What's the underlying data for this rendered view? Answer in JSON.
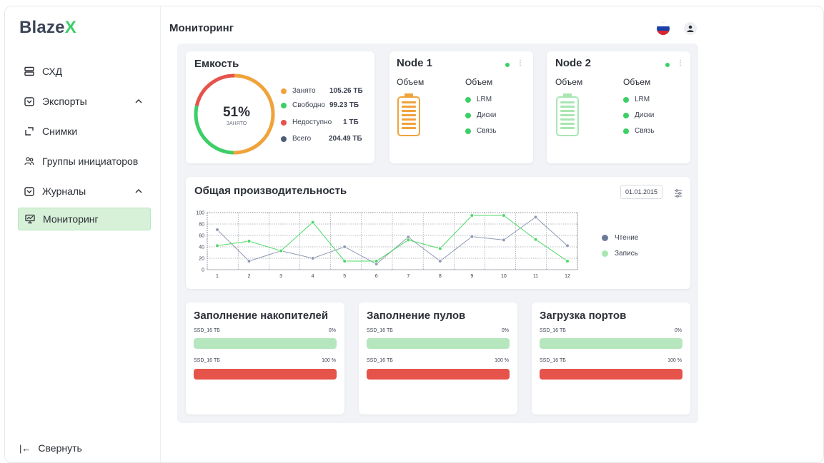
{
  "app": {
    "logo_main": "Blaze",
    "logo_accent": "X"
  },
  "sidebar": {
    "items": [
      {
        "label": "СХД",
        "icon": "storage-icon"
      },
      {
        "label": "Экспорты",
        "icon": "exports-icon",
        "expandable": true
      },
      {
        "label": "Снимки",
        "icon": "snapshots-icon"
      },
      {
        "label": "Группы инициаторов",
        "icon": "groups-icon"
      },
      {
        "label": "Журналы",
        "icon": "journals-icon",
        "expandable": true
      },
      {
        "label": "Мониторинг",
        "icon": "monitoring-icon",
        "active": true
      }
    ],
    "collapse_label": "Свернуть"
  },
  "header": {
    "title": "Мониторинг",
    "language": "ru"
  },
  "capacity": {
    "title": "Емкость",
    "percent": "51%",
    "percent_caption": "занято",
    "legend": [
      {
        "label": "Занято",
        "value": "105.26 ТБ",
        "color": "#f0a33b"
      },
      {
        "label": "Свободно",
        "value": "99.23 ТБ",
        "color": "#3ccf66"
      },
      {
        "label": "Недоступно",
        "value": "1 ТБ",
        "color": "#e5534b"
      },
      {
        "label": "Всего",
        "value": "204.49 ТБ",
        "color": "#4e5d78"
      }
    ]
  },
  "nodes": [
    {
      "title": "Node 1",
      "volume_label": "Объем",
      "volume_label_2": "Объем",
      "items": [
        "LRM",
        "Диски",
        "Связь"
      ],
      "battery_color": "#f0a33b"
    },
    {
      "title": "Node 2",
      "volume_label": "Объем",
      "volume_label_2": "Объем",
      "items": [
        "LRM",
        "Диски",
        "Связь"
      ],
      "battery_color": "#a8e6b2"
    }
  ],
  "performance": {
    "title": "Общая производительность",
    "date": "01.01.2015",
    "legend": [
      {
        "label": "Чтение",
        "color": "#6b7a99"
      },
      {
        "label": "Запись",
        "color": "#a8e6b2"
      }
    ]
  },
  "chart_data": {
    "type": "line",
    "x": [
      1,
      2,
      3,
      4,
      5,
      6,
      7,
      8,
      9,
      10,
      11,
      12
    ],
    "ylim": [
      0,
      100
    ],
    "yticks": [
      0,
      20,
      40,
      60,
      80,
      100
    ],
    "grid": true,
    "legend_position": "right",
    "series": [
      {
        "name": "Чтение",
        "values": [
          70,
          15,
          33,
          20,
          40,
          10,
          57,
          15,
          58,
          52,
          92,
          42
        ],
        "color": "#8f9bb3"
      },
      {
        "name": "Запись",
        "values": [
          42,
          50,
          33,
          83,
          15,
          15,
          52,
          37,
          95,
          95,
          53,
          15
        ],
        "color": "#4cd964"
      }
    ]
  },
  "fill_cards": [
    {
      "title": "Заполнение накопителей",
      "rows": [
        {
          "label": "SSD_16 ТБ",
          "pct": "0%",
          "color": "#b6e6be"
        },
        {
          "label": "SSD_16 ТБ",
          "pct": "100 %",
          "color": "#e5534b"
        }
      ]
    },
    {
      "title": "Заполнение пулов",
      "rows": [
        {
          "label": "SSD_16 ТБ",
          "pct": "0%",
          "color": "#b6e6be"
        },
        {
          "label": "SSD_16 ТБ",
          "pct": "100 %",
          "color": "#e5534b"
        }
      ]
    },
    {
      "title": "Загрузка портов",
      "rows": [
        {
          "label": "SSD_16 ТБ",
          "pct": "0%",
          "color": "#b6e6be"
        },
        {
          "label": "SSD_16 ТБ",
          "pct": "100 %",
          "color": "#e5534b"
        }
      ]
    }
  ]
}
